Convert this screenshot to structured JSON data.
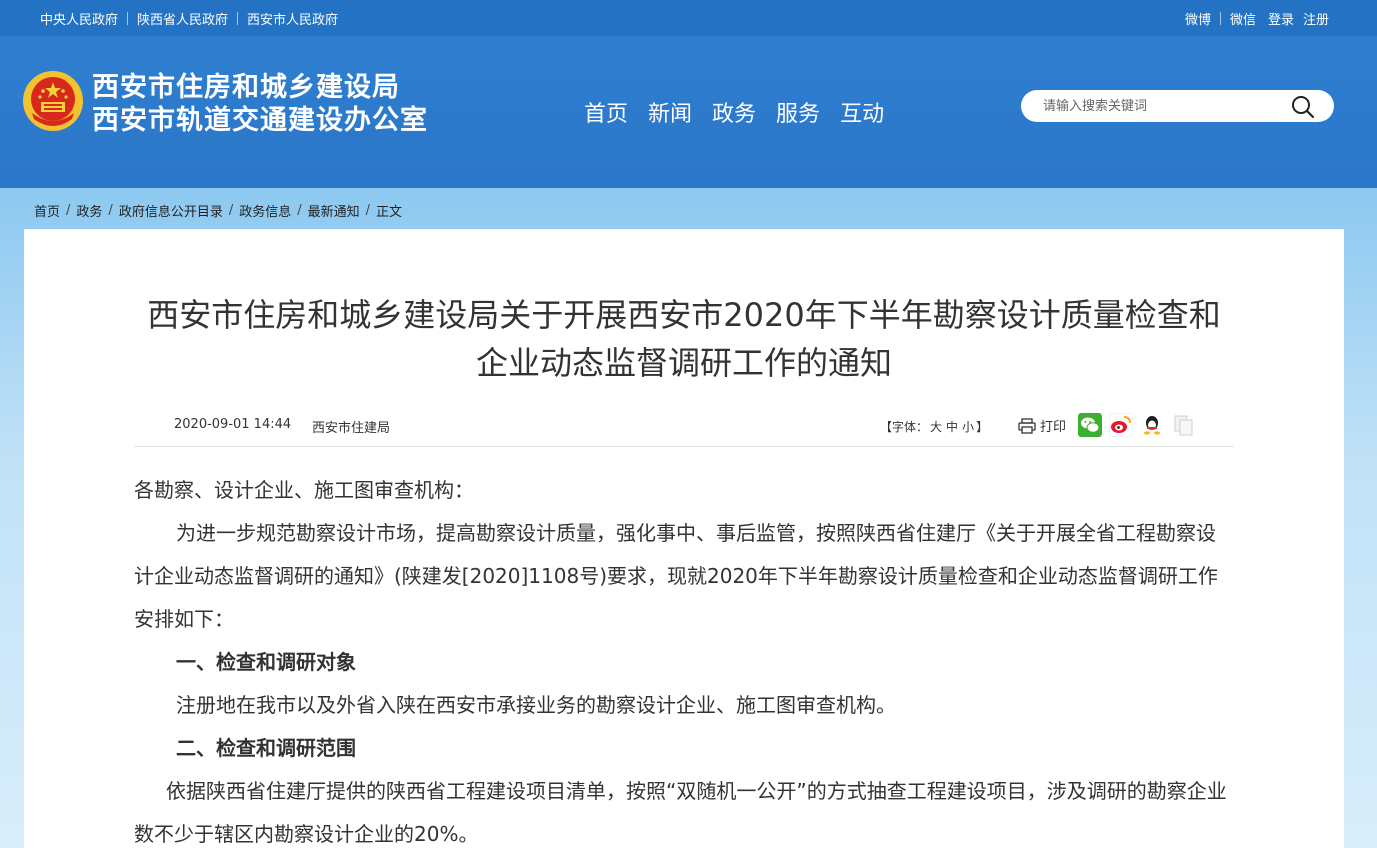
{
  "topbar": {
    "left_links": [
      "中央人民政府",
      "陕西省人民政府",
      "西安市人民政府"
    ],
    "right_links": [
      "微博",
      "微信",
      "登录",
      "注册"
    ]
  },
  "header": {
    "title_line1": "西安市住房和城乡建设局",
    "title_line2": "西安市轨道交通建设办公室",
    "nav": [
      "首页",
      "新闻",
      "政务",
      "服务",
      "互动"
    ],
    "search_placeholder": "请输入搜索关键词"
  },
  "breadcrumb": [
    "首页",
    "政务",
    "政府信息公开目录",
    "政务信息",
    "最新通知",
    "正文"
  ],
  "article": {
    "title": "西安市住房和城乡建设局关于开展西安市2020年下半年勘察设计质量检查和企业动态监督调研工作的通知",
    "date": "2020-09-01 14:44",
    "source": "西安市住建局",
    "font_label_prefix": "【字体：",
    "font_large": "大",
    "font_medium": "中",
    "font_small": "小",
    "font_label_suffix": "】",
    "print_label": "打印",
    "share_icons": [
      "wechat-icon",
      "weibo-icon",
      "qq-icon",
      "copy-icon"
    ],
    "paragraphs": {
      "salutation": "各勘察、设计企业、施工图审查机构：",
      "p1": "为进一步规范勘察设计市场，提高勘察设计质量，强化事中、事后监管，按照陕西省住建厅《关于开展全省工程勘察设计企业动态监督调研的通知》(陕建发[2020]1108号)要求，现就2020年下半年勘察设计质量检查和企业动态监督调研工作安排如下：",
      "h1": "一、检查和调研对象",
      "p2": "注册地在我市以及外省入陕在西安市承接业务的勘察设计企业、施工图审查机构。",
      "h2": "二、检查和调研范围",
      "p3": "依据陕西省住建厅提供的陕西省工程建设项目清单，按照“双随机一公开”的方式抽查工程建设项目，涉及调研的勘察企业数不少于辖区内勘察设计企业的20%。"
    }
  },
  "colors": {
    "topbar": "#2372c4",
    "header": "#2b76c8",
    "wechat": "#3bb030",
    "weibo": "#e6162d"
  }
}
